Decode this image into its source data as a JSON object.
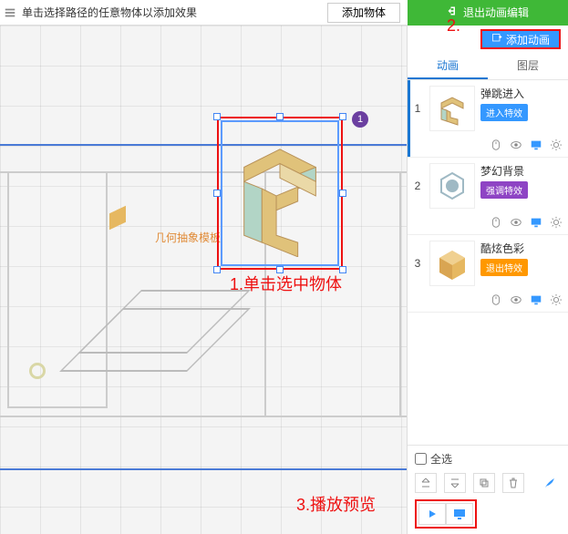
{
  "top": {
    "hint": "单击选择路径的任意物体以添加效果",
    "add_object_label": "添加物体",
    "exit_label": "退出动画编辑"
  },
  "canvas": {
    "label": "几何抽象模板",
    "selected_badge": "1"
  },
  "annotations": {
    "n1_num": "1.",
    "n1_text": "单击选中物体",
    "n2_num": "2.",
    "n3_num": "3.",
    "n3_text": "播放预览"
  },
  "side": {
    "add_anim_label": "添加动画",
    "tabs": {
      "anim": "动画",
      "layer": "图层"
    }
  },
  "effects": [
    {
      "num": "1",
      "name": "弹跳进入",
      "tag": "进入特效",
      "tag_class": "tag-enter"
    },
    {
      "num": "2",
      "name": "梦幻背景",
      "tag": "强调特效",
      "tag_class": "tag-emph"
    },
    {
      "num": "3",
      "name": "酷炫色彩",
      "tag": "退出特效",
      "tag_class": "tag-exit"
    }
  ],
  "bottom": {
    "select_all_label": "全选"
  }
}
